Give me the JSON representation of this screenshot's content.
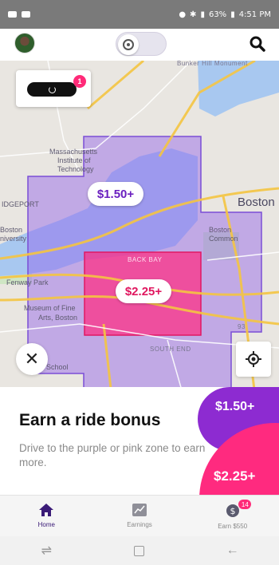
{
  "status_bar": {
    "battery": "63%",
    "time": "4:51 PM"
  },
  "map": {
    "labels": {
      "bunker_hill": "Bunker Hill Monument",
      "mit_1": "Massachusetts",
      "mit_2": "Institute of",
      "mit_3": "Technology",
      "bridgeport": "IDGEPORT",
      "boston": "Boston",
      "boston_u_1": "Boston",
      "boston_u_2": "niversity",
      "boston_common_1": "Boston",
      "boston_common_2": "Common",
      "back_bay": "BACK BAY",
      "fenway_park": "Fenway Park",
      "museum_1": "Museum of Fine",
      "museum_2": "Arts, Boston",
      "south_end": "SOUTH END",
      "school": "School",
      "highway_93": "93"
    },
    "zones": {
      "purple_price": "$1.50+",
      "pink_price": "$2.25+"
    }
  },
  "driver_card": {
    "badge_count": "1"
  },
  "sheet": {
    "title": "Earn a ride bonus",
    "subtitle": "Drive to the purple or pink zone to earn more.",
    "purple_tag": "$1.50+",
    "pink_tag": "$2.25+"
  },
  "tabs": [
    {
      "label": "Home",
      "icon": "home-icon"
    },
    {
      "label": "Earnings",
      "icon": "earnings-chart-icon"
    },
    {
      "label": "Earn $550",
      "icon": "dollar-coin-icon",
      "badge": "14"
    }
  ],
  "colors": {
    "purple_zone": "#8d2bd1",
    "pink_zone": "#ff2a7f",
    "accent_dark": "#3a1b77"
  }
}
